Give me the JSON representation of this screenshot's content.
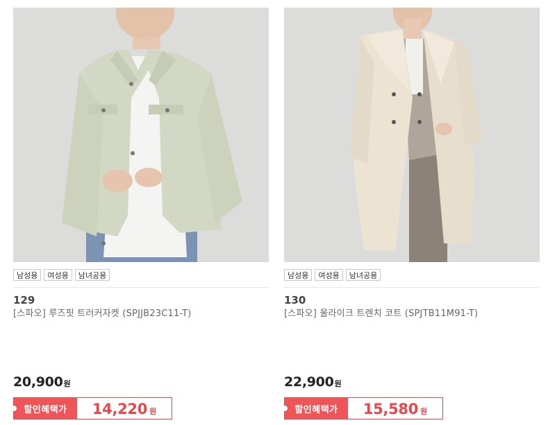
{
  "products": [
    {
      "tags": [
        "남성용",
        "여성용",
        "남녀공용"
      ],
      "number": "129",
      "name": "[스파오] 루즈핏 트러커자켓 (SPJJB23C11-T)",
      "price": "20,900",
      "price_unit": "원",
      "discount_label": "할인혜택가",
      "discount_price": "14,220",
      "discount_unit": "원"
    },
    {
      "tags": [
        "남성용",
        "여성용",
        "남녀공용"
      ],
      "number": "130",
      "name": "[스파오] 울라이크 트렌치 코트 (SPJTB11M91-T)",
      "price": "22,900",
      "price_unit": "원",
      "discount_label": "할인혜택가",
      "discount_price": "15,580",
      "discount_unit": "원"
    }
  ],
  "colors": {
    "accent": "#ee5559",
    "accent_text": "#e8474b",
    "image_bg": "#dededd"
  }
}
